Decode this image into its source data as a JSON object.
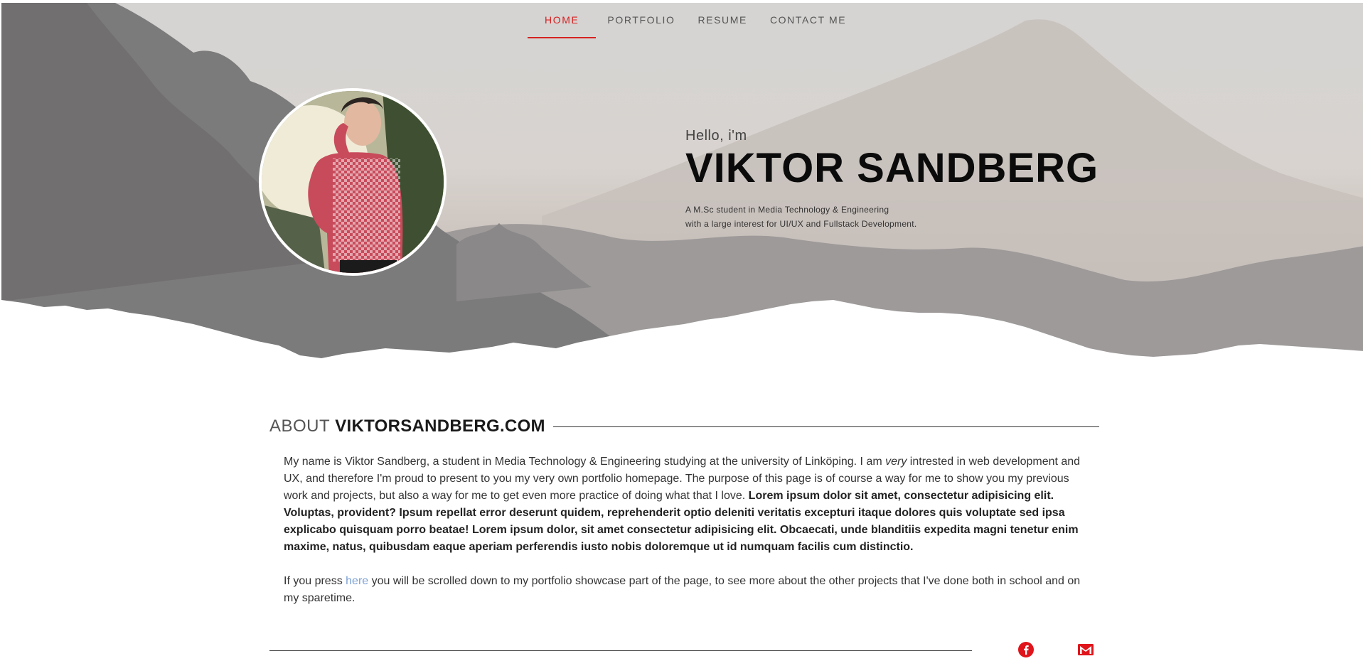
{
  "nav": {
    "items": [
      {
        "label": "HOME",
        "active": true
      },
      {
        "label": "PORTFOLIO",
        "active": false
      },
      {
        "label": "RESUME",
        "active": false
      },
      {
        "label": "CONTACT ME",
        "active": false
      }
    ]
  },
  "hero": {
    "greeting": "Hello, i'm",
    "name": "VIKTOR SANDBERG",
    "subtitle_line1": "A M.Sc student in Media Technology & Engineering",
    "subtitle_line2": "with a large interest for UI/UX and Fullstack Development."
  },
  "about": {
    "heading_light": "ABOUT",
    "heading_bold": "VIKTORSANDBERG.COM",
    "p1_text1": "My name is Viktor Sandberg, a student in Media Technology & Engineering studying at the university of Linköping. I am ",
    "p1_em": "very",
    "p1_text2": " intrested in web development and UX, and therefore I'm proud to present to you my very own portfolio homepage. The purpose of this page is of course a way for me to show you my previous work and projects, but also a way for me to get even more practice of doing what that I love. ",
    "p1_bold": "Lorem ipsum dolor sit amet, consectetur adipisicing elit. Voluptas, provident? Ipsum repellat error deserunt quidem, reprehenderit optio deleniti veritatis excepturi itaque dolores quis voluptate sed ipsa explicabo quisquam porro beatae! Lorem ipsum dolor, sit amet consectetur adipisicing elit. Obcaecati, unde blanditiis expedita magni tenetur enim maxime, natus, quibusdam eaque aperiam perferendis iusto nobis doloremque ut id numquam facilis cum distinctio.",
    "p2_text1": "If you press ",
    "p2_link": "here",
    "p2_text2": " you will be scrolled down to my portfolio showcase part of the page, to see more about the other projects that I've done both in school and on my sparetime."
  },
  "social": {
    "icons": [
      "facebook-icon",
      "gmail-icon"
    ],
    "color": "#e0151b"
  },
  "colors": {
    "accent": "#d62222",
    "link": "#7a9fd4"
  }
}
